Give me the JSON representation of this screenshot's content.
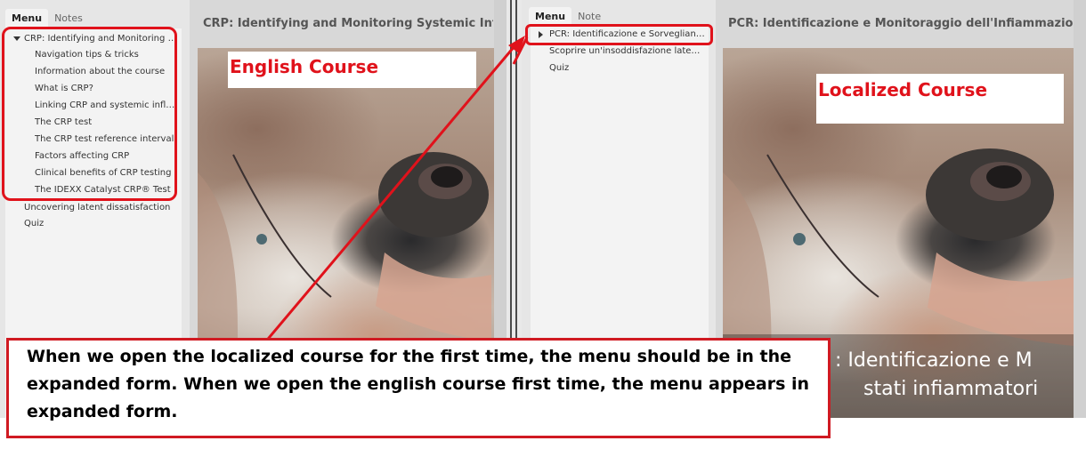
{
  "english": {
    "tabs": [
      "Menu",
      "Notes"
    ],
    "title": "CRP: Identifying and Monitoring Systemic Inflamm",
    "menu": {
      "expanded_item": "CRP: Identifying and Monitoring S…",
      "children": [
        "Navigation tips & tricks",
        "Information about the course",
        "What is CRP?",
        "Linking CRP and systemic infla…",
        "The CRP test",
        "The CRP test reference interval",
        "Factors affecting CRP",
        "Clinical benefits of CRP testing",
        "The IDEXX Catalyst CRP® Test"
      ],
      "items": [
        "Uncovering latent dissatisfaction",
        "Quiz"
      ]
    },
    "label": "English Course"
  },
  "localized": {
    "tabs": [
      "Menu",
      "Note"
    ],
    "title": "PCR: Identificazione e Monitoraggio  dell'Infiammazione S",
    "menu": {
      "collapsed_item": "PCR: Identificazione e Sorveglianz…",
      "items": [
        "Scoprire un'insoddisfazione latente",
        "Quiz"
      ]
    },
    "label": "Localized Course",
    "overlay": {
      "line1": ": Identificazione e M",
      "line2": "stati infiammatori"
    }
  },
  "note": "When we open the localized course for the first time, the menu should be in the expanded form. When we open the english course first time, the menu appears in expanded form.",
  "colors": {
    "annotation_red": "#e0121b",
    "menu_bg": "#f3f3f3",
    "panel_bg": "#d8d8d8"
  }
}
